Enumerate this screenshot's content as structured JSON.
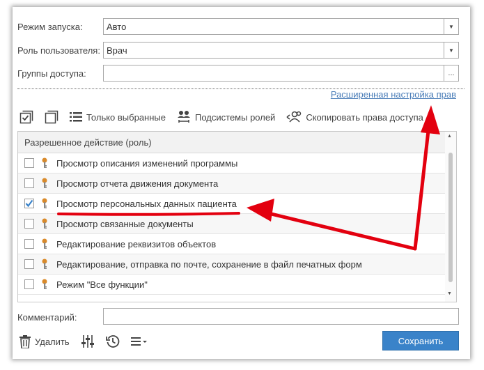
{
  "form": {
    "launch_mode": {
      "label": "Режим запуска:",
      "value": "Авто"
    },
    "user_role": {
      "label": "Роль пользователя:",
      "value": "Врач"
    },
    "access_groups": {
      "label": "Группы доступа:",
      "value": "",
      "button": "..."
    },
    "advanced_link": "Расширенная настройка прав"
  },
  "toolbar": {
    "selected_only": "Только выбранные",
    "role_subsystems": "Подсистемы ролей",
    "copy_rights": "Скопировать права доступа"
  },
  "grid": {
    "header": "Разрешенное действие (роль)",
    "rows": [
      {
        "label": "Просмотр описания изменений программы",
        "checked": false
      },
      {
        "label": "Просмотр отчета движения документа",
        "checked": false
      },
      {
        "label": "Просмотр персональных данных пациента",
        "checked": true
      },
      {
        "label": "Просмотр связанные документы",
        "checked": false
      },
      {
        "label": "Редактирование реквизитов объектов",
        "checked": false
      },
      {
        "label": "Редактирование, отправка по почте, сохранение в файл печатных форм",
        "checked": false
      },
      {
        "label": "Режим \"Все функции\"",
        "checked": false
      }
    ]
  },
  "comment": {
    "label": "Комментарий:",
    "value": ""
  },
  "bottom": {
    "delete": "Удалить",
    "save": "Сохранить"
  },
  "colors": {
    "accent": "#3a83c9",
    "link": "#4a7db8",
    "annotation": "#e3000f",
    "key_icon": "#d98a2b"
  },
  "icons": {
    "select_all": "checkbox-all-icon",
    "deselect_all": "square-stack-icon",
    "list": "list-icon",
    "subsystems": "people-icon",
    "copy": "people-share-icon",
    "delete": "trash-icon",
    "settings": "sliders-icon",
    "history": "history-icon",
    "menu": "hamburger-icon",
    "row": "key-icon"
  }
}
